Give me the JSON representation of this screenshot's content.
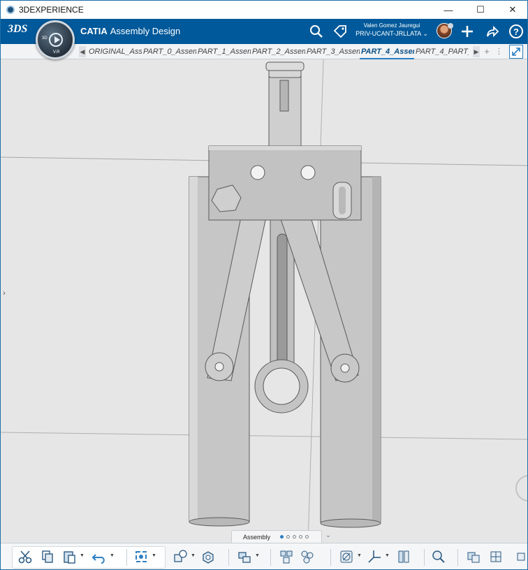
{
  "window": {
    "title": "3DEXPERIENCE",
    "minimize_glyph": "—",
    "maximize_glyph": "☐",
    "close_glyph": "✕"
  },
  "topbar": {
    "brand": "CATIA",
    "app_name": "Assembly Design",
    "logo_text": "3DS",
    "compass_top_label": "3D",
    "compass_bottom_label": "V.R",
    "user_name": "Valen Gomez Jauregui",
    "credentials": "PRIV-UCANT-JRLLATA",
    "icons": [
      "search-icon",
      "tag-icon",
      "plus-icon",
      "share-icon",
      "help-icon"
    ]
  },
  "tabs": [
    {
      "label": "ORIGINAL_Ass",
      "active": false
    },
    {
      "label": "PART_0_Assem",
      "active": false
    },
    {
      "label": "PART_1_Assem",
      "active": false
    },
    {
      "label": "PART_2_Assem",
      "active": false
    },
    {
      "label": "PART_3_Assem",
      "active": false
    },
    {
      "label": "PART_4_Assem",
      "active": true
    },
    {
      "label": "PART_4_PART_",
      "active": false
    }
  ],
  "section": {
    "label": "Assembly",
    "page_count": 5,
    "active_page": 1
  },
  "actionbar": {
    "tools": [
      "cut-icon",
      "copy-icon",
      "paste-icon",
      "undo-icon",
      "update-icon",
      "insert-product-icon",
      "insert-part-icon",
      "replace-icon",
      "explode-icon",
      "assembly-features-icon",
      "section-icon",
      "compass-axis-icon",
      "constraints-icon",
      "measure-icon",
      "clash-icon",
      "tools-icon",
      "more-icon"
    ]
  },
  "colors": {
    "topbar": "#00599A",
    "viewport_bg": "#E6E6E6",
    "part_fill": "#C8C8C8",
    "accent": "#2A7FC2"
  }
}
